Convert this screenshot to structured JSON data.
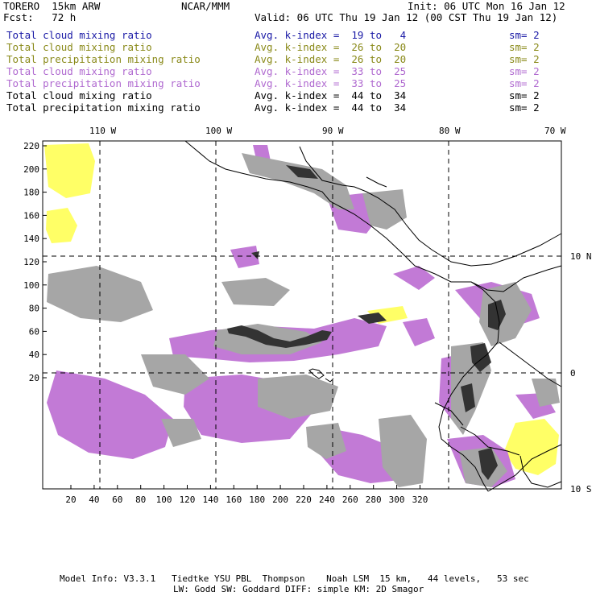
{
  "header": {
    "model": "TORERO  15km ARW",
    "org": "NCAR/MMM",
    "init": "Init: 06 UTC Mon 16 Jan 12",
    "fcst": "Fcst:   72 h",
    "valid": "Valid: 06 UTC Thu 19 Jan 12 (00 CST Thu 19 Jan 12)"
  },
  "legend": [
    {
      "name": "Total cloud mixing ratio",
      "avg": "Avg. k-index =  19 to   4",
      "sm": "sm= 2",
      "color": "#1a1aa6"
    },
    {
      "name": "Total cloud mixing ratio",
      "avg": "Avg. k-index =  26 to  20",
      "sm": "sm= 2",
      "color": "#8a8a1a"
    },
    {
      "name": "Total precipitation mixing ratio",
      "avg": "Avg. k-index =  26 to  20",
      "sm": "sm= 2",
      "color": "#8a8a1a"
    },
    {
      "name": "Total cloud mixing ratio",
      "avg": "Avg. k-index =  33 to  25",
      "sm": "sm= 2",
      "color": "#b06ad0"
    },
    {
      "name": "Total precipitation mixing ratio",
      "avg": "Avg. k-index =  33 to  25",
      "sm": "sm= 2",
      "color": "#b06ad0"
    },
    {
      "name": "Total cloud mixing ratio",
      "avg": "Avg. k-index =  44 to  34",
      "sm": "sm= 2",
      "color": "#000000"
    },
    {
      "name": "Total precipitation mixing ratio",
      "avg": "Avg. k-index =  44 to  34",
      "sm": "sm= 2",
      "color": "#000000"
    }
  ],
  "map": {
    "longitude_labels": [
      "110 W",
      "100 W",
      "90 W",
      "80 W",
      "70 W"
    ],
    "latitude_labels": [
      "10 N",
      "0",
      "10 S"
    ],
    "y_grid_labels": [
      "220",
      "200",
      "180",
      "160",
      "140",
      "120",
      "100",
      "80",
      "60",
      "40",
      "20"
    ],
    "x_grid_labels": [
      "20",
      "40",
      "60",
      "80",
      "100",
      "120",
      "140",
      "160",
      "180",
      "200",
      "220",
      "240",
      "260",
      "280",
      "300",
      "320"
    ],
    "colors": {
      "cloud_light": "#ffff66",
      "cloud_mid": "#c27ad6",
      "cloud_gray": "#a6a6a6",
      "cloud_dark": "#333333",
      "coast": "#000000"
    }
  },
  "footer": {
    "line1": "Model Info: V3.3.1   Tiedtke YSU PBL  Thompson    Noah LSM  15 km,   44 levels,   53 sec",
    "line2": "LW: Godd SW: Goddard DIFF: simple KM: 2D Smagor"
  }
}
